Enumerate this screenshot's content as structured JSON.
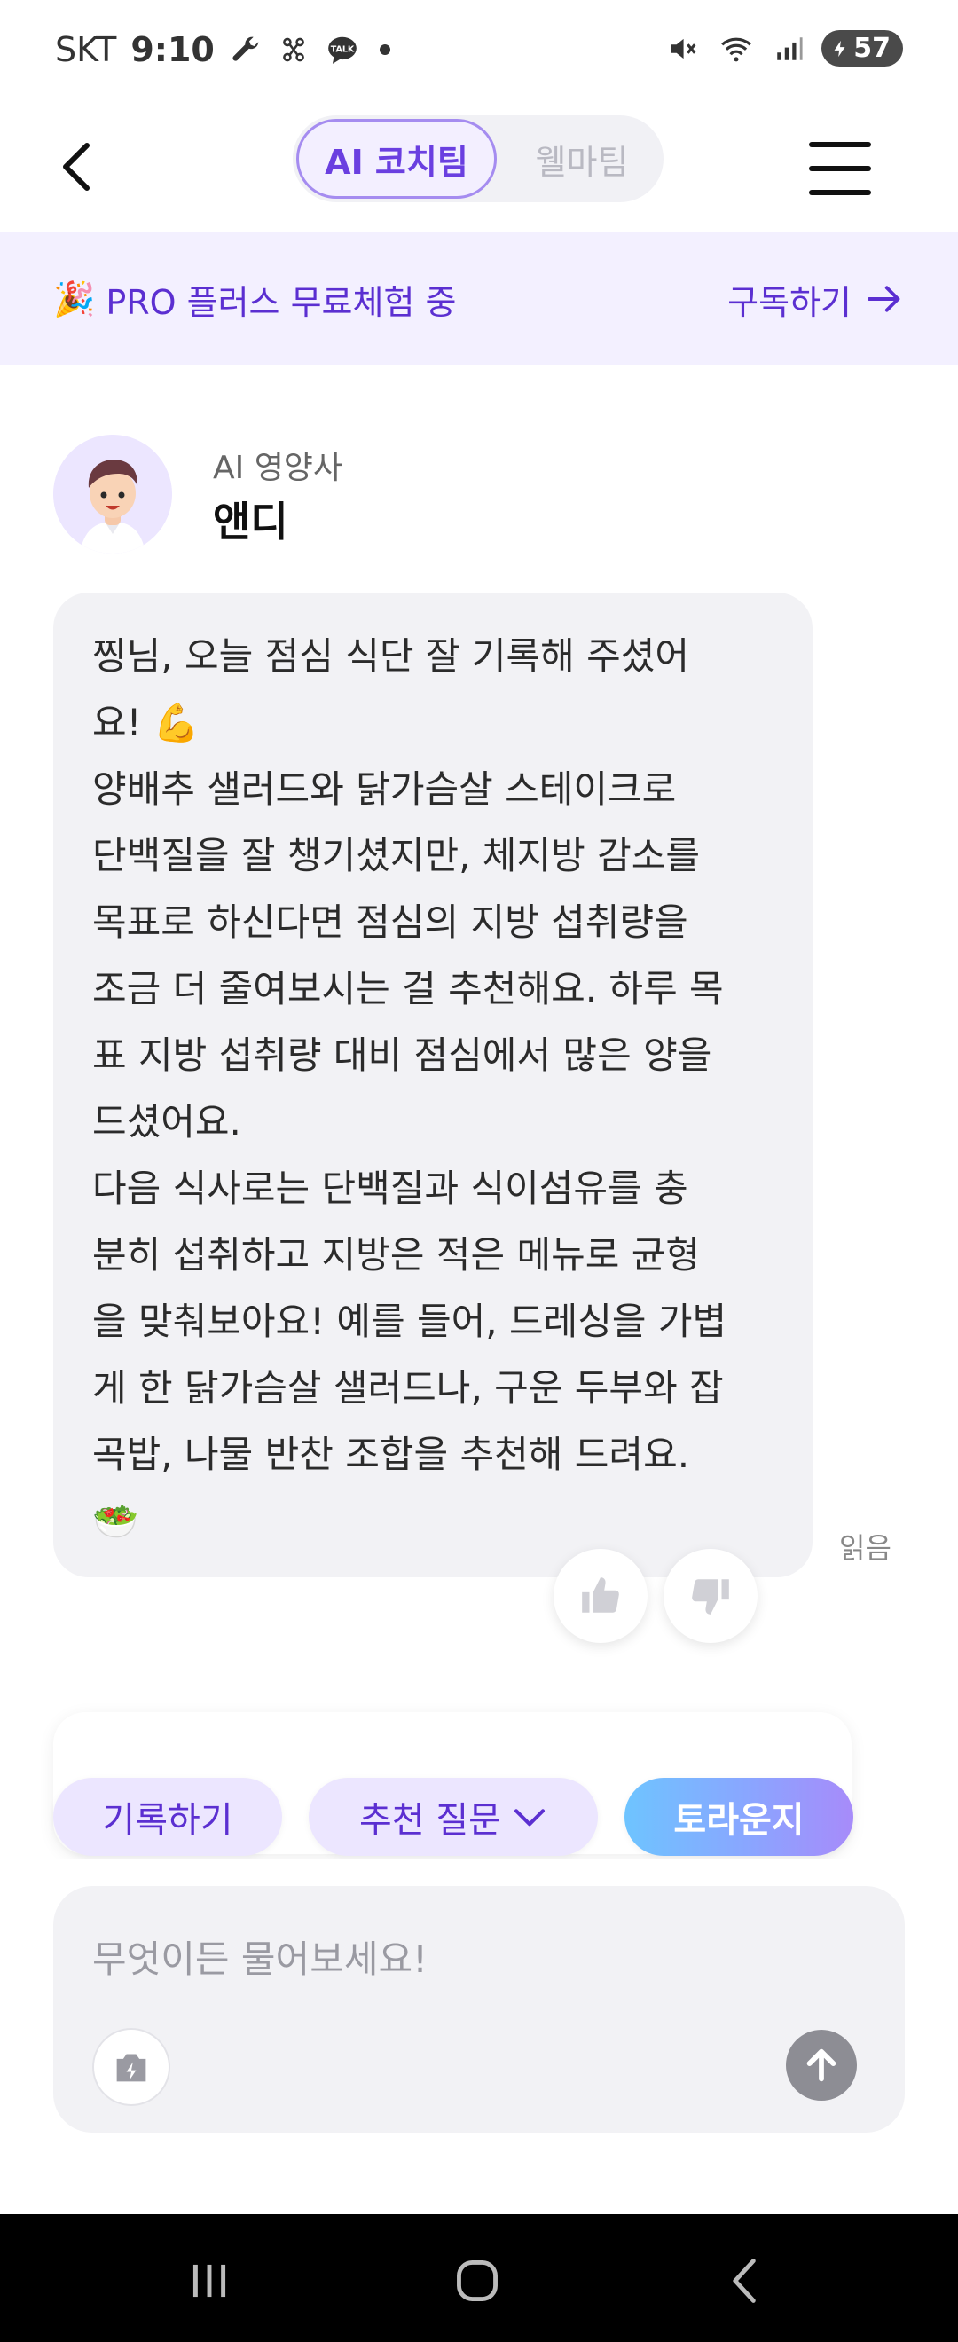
{
  "status_bar": {
    "carrier": "SKT",
    "time": "9:10",
    "battery": "57",
    "icons_left": [
      "wrench-icon",
      "sim-icon",
      "talk-icon",
      "dot-icon"
    ],
    "icons_right": [
      "mute-icon",
      "wifi-icon",
      "signal-icon",
      "battery-icon"
    ]
  },
  "header": {
    "tabs": [
      {
        "label": "AI 코치팀",
        "active": true
      },
      {
        "label": "웰마팀",
        "active": false
      }
    ]
  },
  "promo": {
    "emoji": "🎉",
    "text": "PRO 플러스 무료체험 중",
    "cta": "구독하기"
  },
  "bot": {
    "role": "AI 영양사",
    "name": "앤디"
  },
  "message": {
    "lines": [
      "찡님, 오늘 점심 식단 잘 기록해 주셨어",
      "요! 💪",
      "양배추 샐러드와 닭가슴살 스테이크로",
      "단백질을 잘 챙기셨지만, 체지방 감소를",
      "목표로 하신다면 점심의 지방 섭취량을",
      "조금 더 줄여보시는 걸 추천해요. 하루 목",
      "표 지방 섭취량 대비 점심에서 많은 양을",
      "드셨어요.",
      "다음 식사로는 단백질과 식이섬유를 충",
      "분히 섭취하고 지방은 적은 메뉴로 균형",
      "을 맞춰보아요! 예를 들어, 드레싱을 가볍",
      "게 한 닭가슴살 샐러드나, 구운 두부와 잡",
      "곡밥, 나물 반찬 조합을 추천해 드려요.",
      "🥗"
    ],
    "read_label": "읽음"
  },
  "chips": {
    "record": "기록하기",
    "suggest": "추천 질문",
    "talk": "토라운지"
  },
  "input": {
    "placeholder": "무엇이든 물어보세요!"
  },
  "colors": {
    "accent": "#5b2fd1",
    "promo_bg": "#f3f0ff",
    "bubble_bg": "#f2f2f5"
  }
}
